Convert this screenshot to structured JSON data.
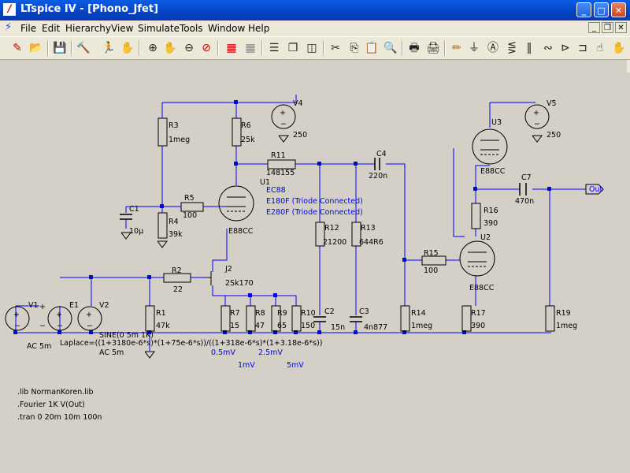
{
  "window": {
    "title": "LTspice IV - [Phono_Jfet]",
    "minimize": "_",
    "maximize": "□",
    "close": "✕"
  },
  "menu": {
    "items": [
      "File",
      "Edit",
      "Hierarchy",
      "View",
      "Simulate",
      "Tools",
      "Window",
      "Help"
    ]
  },
  "mdi_controls": {
    "minimize": "_",
    "restore": "❐",
    "close": "✕"
  },
  "toolbar": {
    "icons": [
      "new-schematic-icon",
      "open-icon",
      "save-icon",
      "control-panel-icon",
      "run-icon",
      "halt-icon",
      "zoom-in-icon",
      "pan-icon",
      "zoom-out-icon",
      "zoom-cancel-icon",
      "waveform-icon",
      "waveform-off-icon",
      "tile-horizontal-icon",
      "cascade-icon",
      "tile-vertical-icon",
      "cut-icon",
      "copy-icon",
      "paste-icon",
      "find-icon",
      "print-setup-icon",
      "print-icon",
      "draw-wire-icon",
      "ground-icon",
      "label-net-icon",
      "resistor-icon",
      "capacitor-icon",
      "inductor-icon",
      "diode-icon",
      "component-icon",
      "move-icon",
      "drag-icon"
    ]
  },
  "schematic": {
    "color_wire": "#0000ff",
    "color_canvas": "#d4d0c8",
    "components": {
      "R3": {
        "name": "R3",
        "value": "1meg"
      },
      "R6": {
        "name": "R6",
        "value": "25k"
      },
      "R11": {
        "name": "R11",
        "value": "148155"
      },
      "C4": {
        "name": "C4",
        "value": "220n"
      },
      "V4": {
        "name": "V4",
        "value": "250"
      },
      "U1": {
        "name": "U1",
        "value": "E88CC"
      },
      "R5": {
        "name": "R5",
        "value": "100"
      },
      "C1": {
        "name": "C1",
        "value": "10µ"
      },
      "R4": {
        "name": "R4",
        "value": "39k"
      },
      "R12": {
        "name": "R12",
        "value": "21200"
      },
      "R13": {
        "name": "R13",
        "value": "644R6"
      },
      "J2": {
        "name": "J2",
        "value": "2Sk170"
      },
      "R2": {
        "name": "R2",
        "value": "22"
      },
      "R1": {
        "name": "R1",
        "value": "47k"
      },
      "R7": {
        "name": "R7",
        "value": "15"
      },
      "R8": {
        "name": "R8",
        "value": "47"
      },
      "R9": {
        "name": "R9",
        "value": "65"
      },
      "R10": {
        "name": "R10",
        "value": "150"
      },
      "C2": {
        "name": "C2",
        "value": "15n"
      },
      "C3": {
        "name": "C3",
        "value": "4n877"
      },
      "R14": {
        "name": "R14",
        "value": "1meg"
      },
      "R15": {
        "name": "R15",
        "value": "100"
      },
      "R16": {
        "name": "R16",
        "value": "390"
      },
      "R17": {
        "name": "R17",
        "value": "390"
      },
      "R19": {
        "name": "R19",
        "value": "1meg"
      },
      "C7": {
        "name": "C7",
        "value": "470n"
      },
      "U2": {
        "name": "U2",
        "value": "E88CC"
      },
      "U3": {
        "name": "U3",
        "value": "E88CC"
      },
      "V5": {
        "name": "V5",
        "value": "250"
      },
      "V1": {
        "name": "V1",
        "value": "AC 5m"
      },
      "E1": {
        "name": "E1"
      },
      "V2": {
        "name": "V2",
        "value": "AC 5m"
      }
    },
    "sine_label": "SINE(0 5m 1K)",
    "laplace": "Laplace=((1+3180e-6*s)*(1+75e-6*s))/((1+318e-6*s)*(1+3.18e-6*s))",
    "tube_notes": [
      "EC88",
      "E180F (Triode Connected)",
      "E280F (Triode Connected)"
    ],
    "levels": [
      "0.5mV",
      "2.5mV",
      "1mV",
      "5mV"
    ],
    "out_label": "Out",
    "directives": [
      ".lib NormanKoren.lib",
      ".Fourier 1K V(Out)",
      ".tran 0 20m 10m 100n"
    ]
  }
}
